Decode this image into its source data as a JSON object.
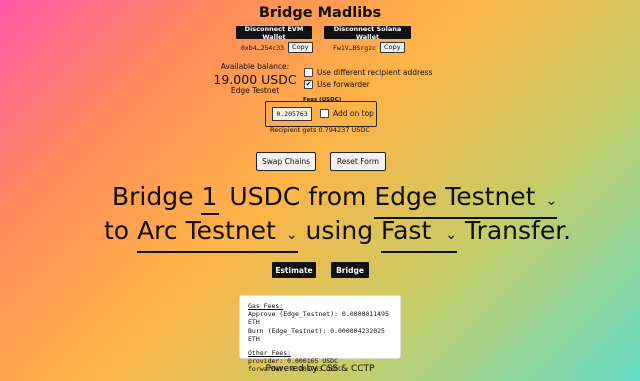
{
  "header": {
    "title": "Bridge Madlibs"
  },
  "wallets": {
    "evm_button": "Disconnect EVM Wallet",
    "solana_button": "Disconnect Solana Wallet",
    "evm_address": "0xb4…254c33",
    "solana_address": "Fw1V…BSrgzc",
    "copy_label": "Copy"
  },
  "balance": {
    "label": "Available balance:",
    "value": "19.000 USDC",
    "network": "Edge Testnet"
  },
  "options": {
    "different_recipient": {
      "label": "Use different recipient address",
      "checked": false
    },
    "forwarder": {
      "label": "Use forwarder",
      "checked": true
    }
  },
  "fees": {
    "legend": "Fees (USDC)",
    "value": "0.205763",
    "add_on_top": {
      "label": "Add on top",
      "checked": false
    },
    "recipient_gets": "Recipient gets 0.794237 USDC"
  },
  "actions": {
    "swap": "Swap Chains",
    "reset": "Reset Form",
    "estimate": "Estimate",
    "bridge": "Bridge"
  },
  "madlib": {
    "w_bridge": "Bridge",
    "amount": "1",
    "w_usdc_from": "USDC from",
    "from_chain": "Edge Testnet",
    "w_to": "to",
    "to_chain": "Arc Testnet",
    "w_using": "using",
    "speed": "Fast",
    "w_transfer": "Transfer.",
    "chevron": "⌄"
  },
  "estimate_output": {
    "gas_header": "Gas Fees:",
    "gas_lines": [
      "Approve (Edge_Testnet): 0.0000011495 ETH",
      "Burn (Edge_Testnet): 0.000004232025 ETH"
    ],
    "other_header": "Other Fees:",
    "other_lines": [
      "provider: 0.000165 USDC",
      "forwarder: 0.205763 USDC"
    ]
  },
  "footer": {
    "text": "Powered by CSS & CCTP"
  }
}
